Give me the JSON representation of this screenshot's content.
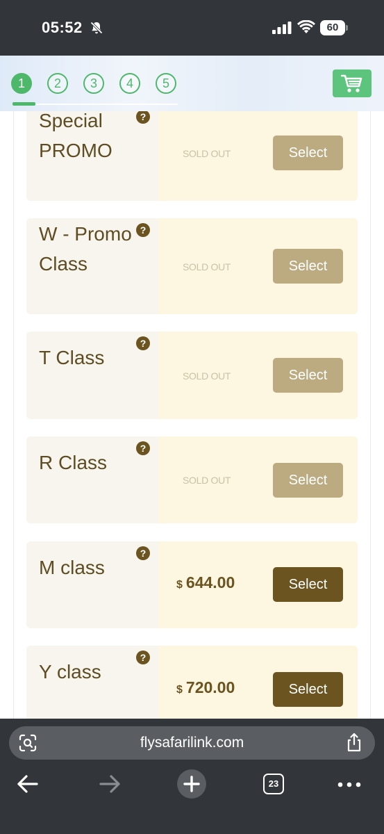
{
  "status_bar": {
    "time": "05:52",
    "battery_level": "60",
    "icons": [
      "bell-slash-icon",
      "signal-icon",
      "wifi-icon",
      "battery-icon"
    ]
  },
  "header": {
    "steps": [
      "1",
      "2",
      "3",
      "4",
      "5"
    ],
    "active_step": "1",
    "cart_icon": "shopping-cart-icon",
    "colors": {
      "accent_green": "#4db86a",
      "cart_green": "#5cc47c"
    }
  },
  "fares": [
    {
      "name_line1": "Special",
      "name_line2": "PROMO",
      "status": "SOLD OUT",
      "currency": "",
      "price": "",
      "select_label": "Select",
      "available": false
    },
    {
      "name_line1": "W - Promo",
      "name_line2": "Class",
      "status": "SOLD OUT",
      "currency": "",
      "price": "",
      "select_label": "Select",
      "available": false
    },
    {
      "name_line1": "T Class",
      "name_line2": "",
      "status": "SOLD OUT",
      "currency": "",
      "price": "",
      "select_label": "Select",
      "available": false
    },
    {
      "name_line1": "R Class",
      "name_line2": "",
      "status": "SOLD OUT",
      "currency": "",
      "price": "",
      "select_label": "Select",
      "available": false
    },
    {
      "name_line1": "M class",
      "name_line2": "",
      "status": "",
      "currency": "$",
      "price": "644.00",
      "select_label": "Select",
      "available": true
    },
    {
      "name_line1": "Y class",
      "name_line2": "",
      "status": "",
      "currency": "$",
      "price": "720.00",
      "select_label": "Select",
      "available": true
    }
  ],
  "help_glyph": "?",
  "fare_colors": {
    "brown": "#6b5420",
    "disabled_button": "#bcab80",
    "price_bg": "#fdf6e0",
    "name_bg": "#f7f5ee"
  },
  "browser": {
    "url": "flysafarilink.com",
    "tab_count": "23",
    "icons": [
      "lens-icon",
      "share-icon",
      "back-arrow-icon",
      "forward-arrow-icon",
      "plus-icon",
      "tabs-icon",
      "more-icon"
    ]
  }
}
